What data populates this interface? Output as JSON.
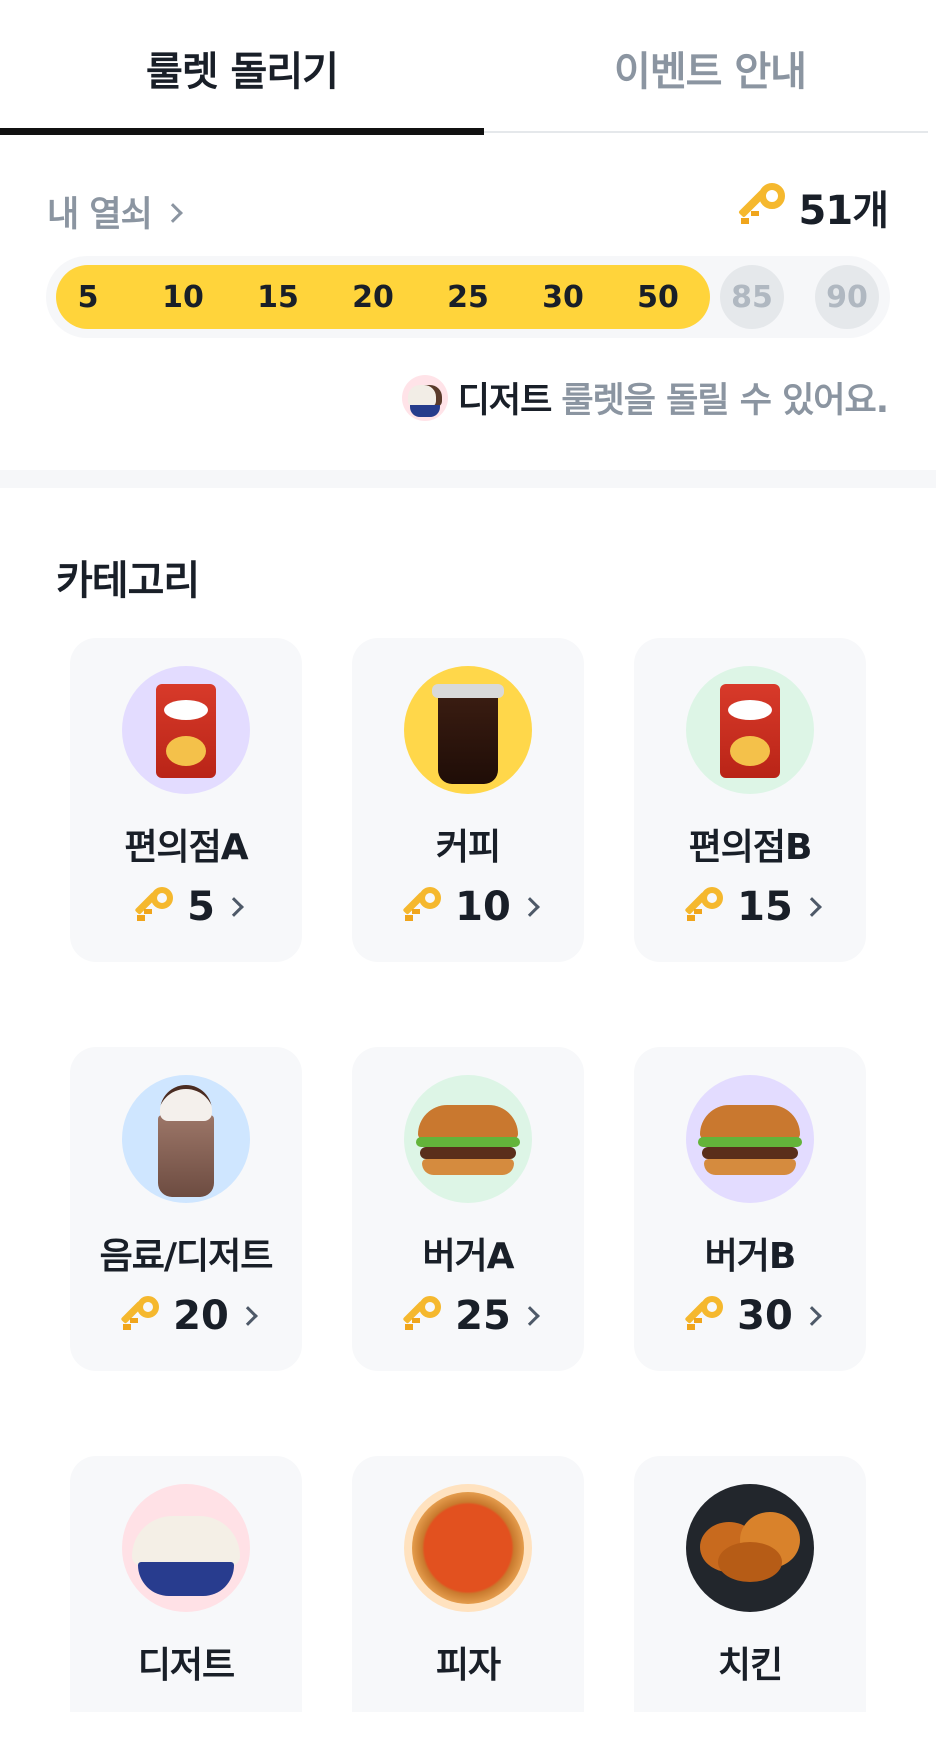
{
  "tabs": [
    {
      "label": "룰렛 돌리기",
      "active": true
    },
    {
      "label": "이벤트 안내",
      "active": false
    }
  ],
  "my_key": {
    "label": "내 열쇠",
    "count": "51개",
    "key_icon": "golden-key-icon"
  },
  "progress": {
    "steps": [
      "5",
      "10",
      "15",
      "20",
      "25",
      "30",
      "50",
      "85",
      "90"
    ],
    "reached_steps": 7,
    "fill_color": "#ffd43b"
  },
  "notice": {
    "highlight": "디저트",
    "text": "룰렛을 돌릴 수 있어요."
  },
  "category": {
    "title": "카테고리",
    "items": [
      {
        "name": "편의점A",
        "cost": "5",
        "icon": "chips-bag-icon"
      },
      {
        "name": "커피",
        "cost": "10",
        "icon": "iced-coffee-icon"
      },
      {
        "name": "편의점B",
        "cost": "15",
        "icon": "chips-bag-icon"
      },
      {
        "name": "음료/디저트",
        "cost": "20",
        "icon": "frappe-icon"
      },
      {
        "name": "버거A",
        "cost": "25",
        "icon": "burger-icon"
      },
      {
        "name": "버거B",
        "cost": "30",
        "icon": "burger-icon"
      },
      {
        "name": "디저트",
        "cost": "",
        "icon": "ice-cream-icon"
      },
      {
        "name": "피자",
        "cost": "",
        "icon": "pizza-icon"
      },
      {
        "name": "치킨",
        "cost": "",
        "icon": "fried-chicken-icon"
      }
    ]
  },
  "colors": {
    "accent_yellow": "#ffd43b",
    "text_primary": "#191f28",
    "text_secondary": "#8b95a1",
    "card_bg": "#f7f8fa"
  }
}
